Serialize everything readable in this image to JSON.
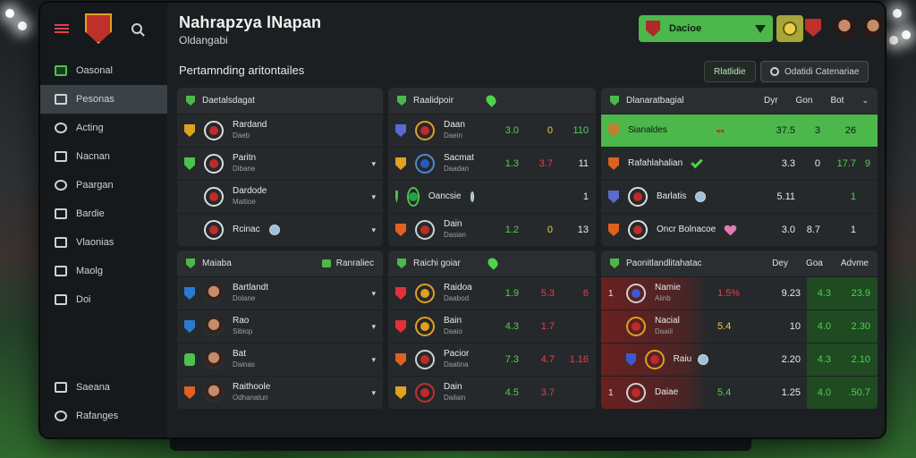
{
  "app": {
    "title": "Nahrapzya lNapan",
    "subtitle": "Oldangabi"
  },
  "sidebar": {
    "items": [
      {
        "label": "Oasonal",
        "icon": "chart-icon",
        "active": false
      },
      {
        "label": "Pesonas",
        "icon": "document-icon",
        "active": true
      },
      {
        "label": "Acting",
        "icon": "globe-icon",
        "active": false
      },
      {
        "label": "Nacnan",
        "icon": "folder-icon",
        "active": false
      },
      {
        "label": "Paargan",
        "icon": "ball-icon",
        "active": false
      },
      {
        "label": "Bardie",
        "icon": "square-icon",
        "active": false
      },
      {
        "label": "Vlaonias",
        "icon": "grid-icon",
        "active": false
      },
      {
        "label": "Maolg",
        "icon": "table-icon",
        "active": false
      },
      {
        "label": "Doi",
        "icon": "message-icon",
        "active": false
      }
    ],
    "bottom": [
      {
        "label": "Saeana",
        "icon": "monitor-icon"
      },
      {
        "label": "Rafanges",
        "icon": "settings-icon"
      }
    ]
  },
  "header": {
    "team_select": "Dacioe"
  },
  "section": {
    "title": "Pertamnding aritontailes",
    "pill1": "Rlatlidie",
    "pill2": "Odatidi Catenariae"
  },
  "panel1": {
    "title": "Daetalsdagat",
    "rows": [
      {
        "name": "Rardand",
        "sub": "Daeb"
      },
      {
        "name": "Paritn",
        "sub": "Dibane"
      },
      {
        "name": "Dardode",
        "sub": "Maitioe"
      },
      {
        "name": "Rcinac",
        "sub": ""
      }
    ]
  },
  "panel2": {
    "title": "Raalidpoir",
    "rows": [
      {
        "name": "Daan",
        "sub": "Daein",
        "v": [
          "3.0",
          "0",
          "110"
        ],
        "c": [
          "g",
          "y",
          "g"
        ]
      },
      {
        "name": "Sacmat",
        "sub": "Daadan",
        "v": [
          "1.3",
          "3.7",
          "11"
        ],
        "c": [
          "g",
          "r",
          "w"
        ]
      },
      {
        "name": "Oancsie",
        "sub": "",
        "v": [
          "",
          "",
          "1"
        ],
        "c": [
          "w",
          "w",
          "w"
        ]
      },
      {
        "name": "Dain",
        "sub": "Dasian",
        "v": [
          "1.2",
          "0",
          "13"
        ],
        "c": [
          "g",
          "y",
          "w"
        ]
      }
    ]
  },
  "panel3": {
    "title": "Dlanaratbagial",
    "cols": [
      "Dyr",
      "Gon",
      "Bot"
    ],
    "rows": [
      {
        "name": "Sianaldes",
        "v": [
          "37.5",
          "3",
          "26"
        ],
        "c": [
          "b",
          "b",
          "b"
        ],
        "hl": true
      },
      {
        "name": "Rafahlahalian",
        "v": [
          "3.3",
          "0",
          "17.7"
        ],
        "c": [
          "w",
          "w",
          "g"
        ],
        "extra": "9"
      },
      {
        "name": "Barlatis",
        "v": [
          "5.11",
          "",
          "1"
        ],
        "c": [
          "w",
          "w",
          "g"
        ]
      },
      {
        "name": "Oncr Bolnacoe",
        "v": [
          "3.0",
          "8.7",
          "1"
        ],
        "c": [
          "w",
          "w",
          "w"
        ]
      }
    ]
  },
  "panel4": {
    "title": "Maiaba",
    "action": "Ranraliec",
    "rows": [
      {
        "name": "Bartlandt",
        "sub": "Dolane"
      },
      {
        "name": "Rao",
        "sub": "Sibiop"
      },
      {
        "name": "Bat",
        "sub": "Dainas"
      },
      {
        "name": "Raithoole",
        "sub": "Odhanatun"
      }
    ]
  },
  "panel5": {
    "title": "Raichi goiar",
    "rows": [
      {
        "name": "Raidoa",
        "sub": "Daabod",
        "v": [
          "1.9",
          "5.3",
          "6"
        ],
        "c": [
          "g",
          "r",
          "r"
        ]
      },
      {
        "name": "Bain",
        "sub": "Daaio",
        "v": [
          "4.3",
          "1.7",
          ""
        ],
        "c": [
          "g",
          "r",
          "w"
        ]
      },
      {
        "name": "Pacior",
        "sub": "Daatina",
        "v": [
          "7.3",
          "4.7",
          "1.16"
        ],
        "c": [
          "g",
          "r",
          "r"
        ]
      },
      {
        "name": "Dain",
        "sub": "Dailain",
        "v": [
          "4.5",
          "3.7",
          ""
        ],
        "c": [
          "g",
          "r",
          "w"
        ]
      }
    ]
  },
  "panel6": {
    "title": "Paonitlandlitahatac",
    "cols": [
      "Dey",
      "Goa",
      "Advme"
    ],
    "rows": [
      {
        "rank": "1",
        "name": "Namie",
        "sub": "Aiinb",
        "v1": "1.5%",
        "v1c": "r",
        "v": [
          "9.23",
          "4.3",
          "23.9"
        ]
      },
      {
        "rank": "",
        "name": "Nacial",
        "sub": "Daaiii",
        "v1": "5.4",
        "v1c": "y",
        "v": [
          "10",
          "4.0",
          "2.30"
        ]
      },
      {
        "rank": "",
        "name": "Raiu",
        "sub": "",
        "v1": "",
        "v1c": "w",
        "v": [
          "2.20",
          "4.3",
          "2.10"
        ]
      },
      {
        "rank": "1",
        "name": "Daiae",
        "sub": "",
        "v1": "5.4",
        "v1c": "g",
        "v": [
          "1.25",
          "4.0",
          ".50.7"
        ]
      }
    ]
  }
}
